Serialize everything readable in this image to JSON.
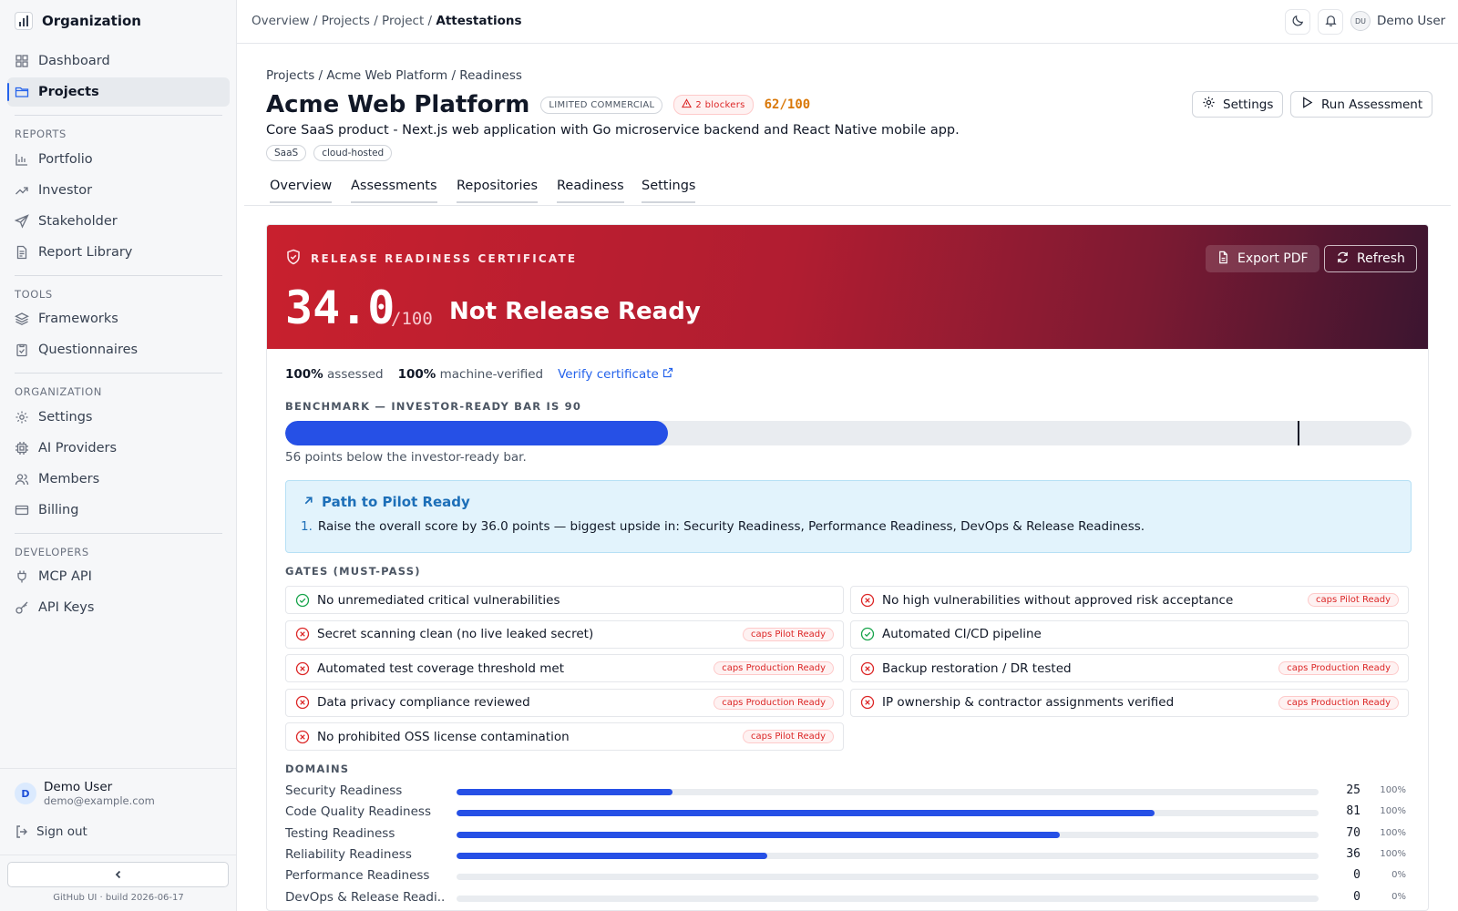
{
  "sidebar": {
    "org_name": "Organization",
    "items_main": [
      {
        "label": "Dashboard",
        "icon": "dashboard-icon"
      },
      {
        "label": "Projects",
        "icon": "folder-icon",
        "active": true
      }
    ],
    "section_reports": "REPORTS",
    "items_reports": [
      {
        "label": "Portfolio",
        "icon": "bar-chart-icon"
      },
      {
        "label": "Investor",
        "icon": "trending-up-icon"
      },
      {
        "label": "Stakeholder",
        "icon": "send-icon"
      },
      {
        "label": "Report Library",
        "icon": "file-text-icon"
      }
    ],
    "section_tools": "TOOLS",
    "items_tools": [
      {
        "label": "Frameworks",
        "icon": "layers-icon"
      },
      {
        "label": "Questionnaires",
        "icon": "clipboard-icon"
      }
    ],
    "section_org": "ORGANIZATION",
    "items_org": [
      {
        "label": "Settings",
        "icon": "gear-icon"
      },
      {
        "label": "AI Providers",
        "icon": "cpu-icon"
      },
      {
        "label": "Members",
        "icon": "users-icon"
      },
      {
        "label": "Billing",
        "icon": "credit-card-icon"
      }
    ],
    "section_dev": "DEVELOPERS",
    "items_dev": [
      {
        "label": "MCP API",
        "icon": "plug-icon"
      },
      {
        "label": "API Keys",
        "icon": "key-icon"
      }
    ],
    "user": {
      "initial": "D",
      "name": "Demo User",
      "email": "demo@example.com"
    },
    "sign_out": "Sign out",
    "build": "GitHub UI · build 2026-06-17"
  },
  "topbar": {
    "breadcrumb": "Overview / Projects / Project / ",
    "breadcrumb_current": "Attestations",
    "user_initials": "DU",
    "user_name": "Demo User"
  },
  "header": {
    "breadcrumb": "Projects / Acme Web Platform / Readiness",
    "title": "Acme Web Platform",
    "license_badge": "LIMITED COMMERCIAL",
    "blockers_badge": "2 blockers",
    "score": "62/100",
    "settings_label": "Settings",
    "run_label": "Run Assessment",
    "description": "Core SaaS product - Next.js web application with Go microservice backend and React Native mobile app.",
    "tags": [
      "SaaS",
      "cloud-hosted"
    ],
    "tabs": [
      "Overview",
      "Assessments",
      "Repositories",
      "Readiness",
      "Settings"
    ]
  },
  "certificate": {
    "label": "RELEASE READINESS CERTIFICATE",
    "score": "34.0",
    "max": "/100",
    "status": "Not Release Ready",
    "export_label": "Export PDF",
    "refresh_label": "Refresh",
    "assessed_value": "100%",
    "assessed_label": "assessed",
    "verified_value": "100%",
    "verified_label": "machine-verified",
    "verify_link": "Verify certificate",
    "benchmark_title": "BENCHMARK — INVESTOR-READY BAR IS 90",
    "benchmark_score": 34,
    "benchmark_bar": 90,
    "benchmark_note": "56 points below the investor-ready bar.",
    "path_title": "Path to Pilot Ready",
    "path_items": [
      {
        "num": "1.",
        "text": "Raise the overall score by 36.0 points — biggest upside in: Security Readiness, Performance Readiness, DevOps & Release Readiness."
      }
    ],
    "gates_title": "GATES (MUST-PASS)",
    "gates": [
      {
        "label": "No unremediated critical vulnerabilities",
        "pass": true,
        "caps": ""
      },
      {
        "label": "No high vulnerabilities without approved risk acceptance",
        "pass": false,
        "caps": "caps Pilot Ready"
      },
      {
        "label": "Secret scanning clean (no live leaked secret)",
        "pass": false,
        "caps": "caps Pilot Ready"
      },
      {
        "label": "Automated CI/CD pipeline",
        "pass": true,
        "caps": ""
      },
      {
        "label": "Automated test coverage threshold met",
        "pass": false,
        "caps": "caps Production Ready"
      },
      {
        "label": "Backup restoration / DR tested",
        "pass": false,
        "caps": "caps Production Ready"
      },
      {
        "label": "Data privacy compliance reviewed",
        "pass": false,
        "caps": "caps Production Ready"
      },
      {
        "label": "IP ownership & contractor assignments verified",
        "pass": false,
        "caps": "caps Production Ready"
      },
      {
        "label": "No prohibited OSS license contamination",
        "pass": false,
        "caps": "caps Pilot Ready"
      }
    ],
    "domains_title": "DOMAINS",
    "domains": [
      {
        "label": "Security Readiness",
        "score": 25,
        "coverage": "100%"
      },
      {
        "label": "Code Quality Readiness",
        "score": 81,
        "coverage": "100%"
      },
      {
        "label": "Testing Readiness",
        "score": 70,
        "coverage": "100%"
      },
      {
        "label": "Reliability Readiness",
        "score": 36,
        "coverage": "100%"
      },
      {
        "label": "Performance Readiness",
        "score": 0,
        "coverage": "0%"
      },
      {
        "label": "DevOps & Release Readi...",
        "score": 0,
        "coverage": "0%"
      }
    ]
  },
  "colors": {
    "accent": "#2650e6",
    "danger": "#dc2626",
    "success": "#16a34a",
    "cert_red": "#c8202e",
    "warning": "#d97706"
  }
}
